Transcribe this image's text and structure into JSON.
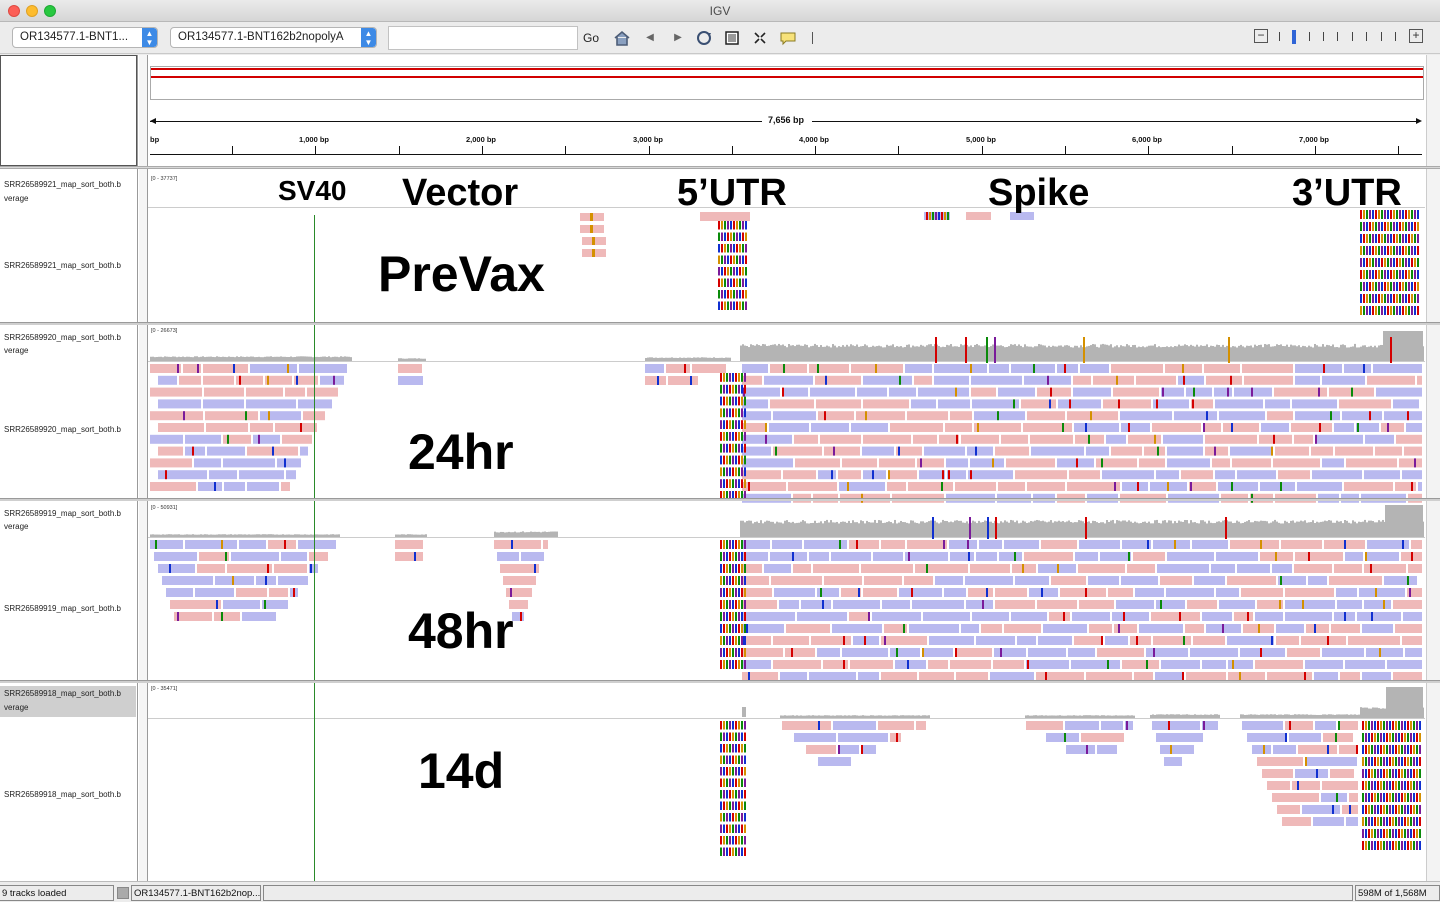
{
  "window": {
    "title": "IGV"
  },
  "toolbar": {
    "genome_value": "OR134577.1-BNT1...",
    "chromosome_value": "OR134577.1-BNT162b2nopolyA",
    "locus_value": "",
    "go_label": "Go"
  },
  "ruler": {
    "span_label": "7,656 bp",
    "tick_labels": [
      "bp",
      "1,000 bp",
      "2,000 bp",
      "3,000 bp",
      "4,000 bp",
      "5,000 bp",
      "6,000 bp",
      "7,000 bp"
    ]
  },
  "tracks": [
    {
      "coverage_name": "SRR26589921_map_sort_both.b",
      "coverage_suffix": "verage",
      "reads_name": "SRR26589921_map_sort_both.b",
      "scale": "[0 - 37737]",
      "overlay": "PreVax"
    },
    {
      "coverage_name": "SRR26589920_map_sort_both.b",
      "coverage_suffix": "verage",
      "reads_name": "SRR26589920_map_sort_both.b",
      "scale": "[0 - 26673]",
      "overlay": "24hr"
    },
    {
      "coverage_name": "SRR26589919_map_sort_both.b",
      "coverage_suffix": "verage",
      "reads_name": "SRR26589919_map_sort_both.b",
      "scale": "[0 - 50931]",
      "overlay": "48hr"
    },
    {
      "coverage_name": "SRR26589918_map_sort_both.b",
      "coverage_suffix": "verage",
      "reads_name": "SRR26589918_map_sort_both.b",
      "scale": "[0 - 35471]",
      "overlay": "14d"
    }
  ],
  "region_labels": [
    "SV40",
    "Vector",
    "5’UTR",
    "Spike",
    "3’UTR"
  ],
  "status": {
    "tracks_loaded": "9 tracks loaded",
    "locus": "OR134577.1-BNT162b2nop...",
    "memory": "598M of 1,568M"
  },
  "colors": {
    "read_pink": "#efb9b9",
    "read_blue": "#b9b9ef",
    "coverage_gray": "#b4b4b4",
    "ideogram_red": "#d10000"
  }
}
